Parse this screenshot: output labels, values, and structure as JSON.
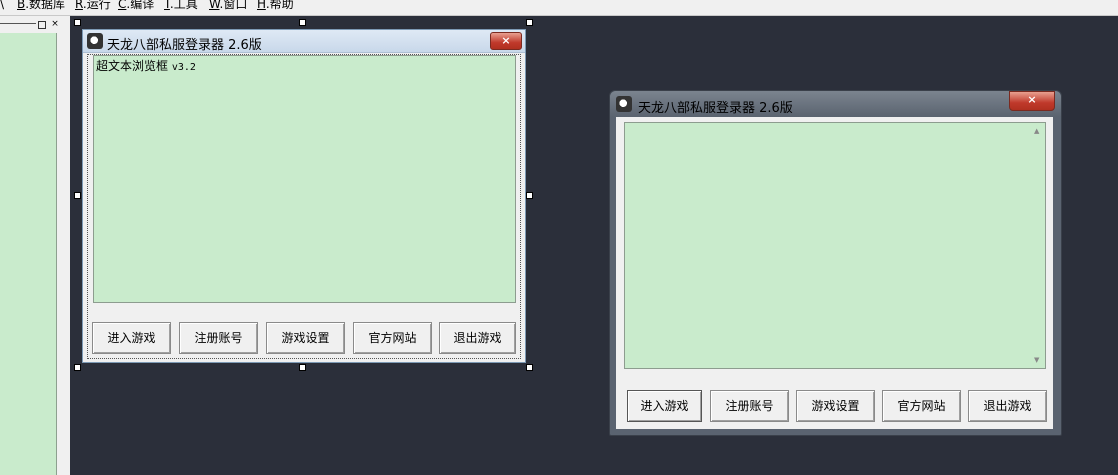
{
  "menubar": {
    "items": [
      {
        "key": "B",
        "label": ".数据库"
      },
      {
        "key": "R",
        "label": ".运行"
      },
      {
        "key": "C",
        "label": ".编译"
      },
      {
        "key": "T",
        "label": ".工具"
      },
      {
        "key": "W",
        "label": ".窗口"
      },
      {
        "key": "H",
        "label": ".帮助"
      }
    ]
  },
  "design_window": {
    "title": "天龙八部私服登录器 2.6版",
    "close_glyph": "×",
    "browser_caption": "超文本浏览框",
    "browser_version": "v3.2",
    "buttons": [
      "进入游戏",
      "注册账号",
      "游戏设置",
      "官方网站",
      "退出游戏"
    ]
  },
  "run_window": {
    "title": "天龙八部私服登录器 2.6版",
    "close_glyph": "×",
    "buttons": [
      "进入游戏",
      "注册账号",
      "游戏设置",
      "官方网站",
      "退出游戏"
    ]
  },
  "colors": {
    "browser_bg": "#c9ebcc",
    "desktop_bg": "#2b2f3a",
    "close_red": "#c0392b"
  }
}
